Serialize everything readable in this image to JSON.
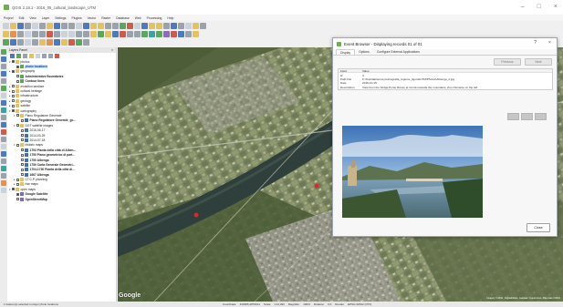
{
  "window": {
    "title": "QGIS 2.18.1 - 2016_05_cultural_landscape_UTM",
    "minimize": "–",
    "close": "×"
  },
  "menu": [
    "Project",
    "Edit",
    "View",
    "Layer",
    "Settings",
    "Plugins",
    "Vector",
    "Raster",
    "Database",
    "Web",
    "Processing",
    "Help"
  ],
  "layers_panel": {
    "title": "Layers Panel",
    "close": "×",
    "items": [
      {
        "label": "photos",
        "indent": 0,
        "checked": true,
        "icon": "folder",
        "twisty": "▾"
      },
      {
        "label": "photo locations",
        "indent": 1,
        "checked": true,
        "icon": "vector",
        "bold": true,
        "selected": true
      },
      {
        "label": "geography",
        "indent": 0,
        "checked": true,
        "icon": "folder",
        "twisty": "▸"
      },
      {
        "label": "Administrative Boundaries",
        "indent": 1,
        "checked": false,
        "icon": "vector",
        "bold": true
      },
      {
        "label": "Contour lines",
        "indent": 1,
        "checked": false,
        "icon": "vector",
        "bold": true
      },
      {
        "label": "evolution landuse",
        "indent": 0,
        "checked": false,
        "icon": "folder",
        "twisty": "▸"
      },
      {
        "label": "cultural heritage",
        "indent": 0,
        "checked": false,
        "icon": "folder",
        "twisty": "▸"
      },
      {
        "label": "infrastructure",
        "indent": 0,
        "checked": false,
        "icon": "folder",
        "twisty": "▸"
      },
      {
        "label": "geology",
        "indent": 0,
        "checked": false,
        "icon": "folder",
        "twisty": "▸"
      },
      {
        "label": "satelite",
        "indent": 0,
        "checked": false,
        "icon": "folder",
        "twisty": "▸"
      },
      {
        "label": "cartography",
        "indent": 0,
        "checked": true,
        "icon": "folder",
        "twisty": "▾"
      },
      {
        "label": "Piano Regolatore Generale",
        "indent": 1,
        "checked": false,
        "icon": "folder",
        "twisty": "▾"
      },
      {
        "label": "Piano Regolatore Generale_gc...",
        "indent": 2,
        "checked": false,
        "icon": "raster",
        "bold": true
      },
      {
        "label": "DGT satellite images",
        "indent": 1,
        "checked": false,
        "icon": "folder",
        "twisty": "▾"
      },
      {
        "label": "2016-06-17",
        "indent": 2,
        "checked": false,
        "icon": "raster"
      },
      {
        "label": "2014-03-29",
        "indent": 2,
        "checked": false,
        "icon": "raster"
      },
      {
        "label": "2014-07-18",
        "indent": 2,
        "checked": false,
        "icon": "raster"
      },
      {
        "label": "historic maps",
        "indent": 1,
        "checked": false,
        "icon": "folder",
        "twisty": "▾"
      },
      {
        "label": "1753 Pianta della città di Alben...",
        "indent": 2,
        "checked": false,
        "icon": "raster",
        "bold": true
      },
      {
        "label": "1750 Piano geometrico di part...",
        "indent": 2,
        "checked": false,
        "icon": "raster",
        "bold": true
      },
      {
        "label": "1750 Albenga",
        "indent": 2,
        "checked": false,
        "icon": "raster",
        "bold": true
      },
      {
        "label": "1750 Carta Generale Geometri...",
        "indent": 2,
        "checked": false,
        "icon": "raster",
        "bold": true
      },
      {
        "label": "1704-1730 Pianta della città di...",
        "indent": 2,
        "checked": false,
        "icon": "raster",
        "bold": true
      },
      {
        "label": "1667 Albenga",
        "indent": 2,
        "checked": false,
        "icon": "raster",
        "bold": true
      },
      {
        "label": "CT.C.P. planning",
        "indent": 1,
        "checked": false,
        "icon": "folder",
        "twisty": "▸"
      },
      {
        "label": "rise maps",
        "indent": 1,
        "checked": false,
        "icon": "folder",
        "twisty": "▸"
      },
      {
        "label": "open maps",
        "indent": 0,
        "checked": true,
        "icon": "folder",
        "twisty": "▾"
      },
      {
        "label": "Google Satellite",
        "indent": 1,
        "checked": true,
        "icon": "web",
        "bold": true
      },
      {
        "label": "OpenStreetMap",
        "indent": 1,
        "checked": false,
        "icon": "web",
        "bold": true
      }
    ]
  },
  "map": {
    "provider_mark": "Google",
    "attribution": "Imagery ©2016 , DigitalGlobe, Landsat / Copernicus, Map data ©2016"
  },
  "dialog": {
    "title": "Event Browser - Displaying records 01 of 01",
    "help": "?",
    "close": "×",
    "tabs": [
      {
        "label": "Display",
        "active": true
      },
      {
        "label": "Options",
        "active": false
      },
      {
        "label": "Configure External Applications",
        "active": false
      }
    ],
    "previous_label": "Previous",
    "next_label": "Next",
    "table_headers": {
      "field": "Field",
      "value": "Value"
    },
    "attributes": [
      {
        "field": "id",
        "value": "4"
      },
      {
        "field": "Path File",
        "value": "F:\\Tesi\\dati\\survey\\cartografia_regione_liguria\\UTM\\Photos\\Albenga_2.jpg"
      },
      {
        "field": "Date",
        "value": "2016-10-15"
      },
      {
        "field": "Description",
        "value": "View from the bridge Ponte Rosso at Centa towards the mountains. Zoo Osmanie on the left"
      }
    ],
    "close_button": "Close"
  },
  "statusbar": {
    "message": "1 feature(s) selected on layer photo locations",
    "coordinate_label": "Coordinate",
    "coordinate": "433965,4879011",
    "scale_label": "Scale",
    "scale": "1:11,393",
    "magnifier_label": "Magnifier",
    "magnifier": "100%",
    "rotation_label": "Rotation",
    "rotation": "0.0",
    "render_label": "Render",
    "crs": "EPSG:32632 (OTF)"
  }
}
